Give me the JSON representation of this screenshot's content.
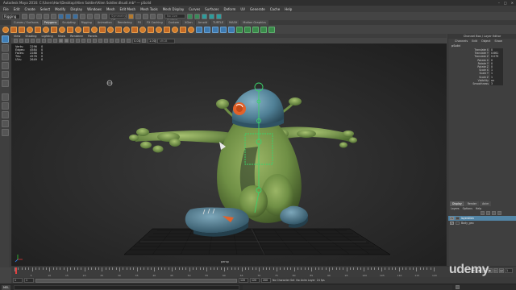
{
  "window": {
    "title": "Autodesk Maya 2016: C:\\Users\\Hari\\Desktop\\Alien Soldier\\Alien Soldier.dlsudi.mb* --- pSolid"
  },
  "menubar": [
    "File",
    "Edit",
    "Create",
    "Select",
    "Modify",
    "Display",
    "Windows",
    "Mesh",
    "Edit Mesh",
    "Mesh Tools",
    "Mesh Display",
    "Curves",
    "Surfaces",
    "Deform",
    "UV",
    "Generate",
    "Cache",
    "Help"
  ],
  "statusline": {
    "mode": "Rigging",
    "search_placeholder": "Symmetry: Off",
    "live_label": "No Live Surface"
  },
  "shelf_tabs": [
    "Curves / Surfaces",
    "Polygons",
    "Sculpting",
    "Rigging",
    "Animation",
    "Rendering",
    "FX",
    "FX Caching",
    "Custom",
    "XGen",
    "Arnold",
    "TURTLE",
    "MASH",
    "Motion Graphics"
  ],
  "active_shelf_tab": "Polygons",
  "panel_menu": [
    "View",
    "Shading",
    "Lighting",
    "Show",
    "Renderer",
    "Panels"
  ],
  "hud": {
    "rows": [
      {
        "label": "Verts:",
        "a": "2296",
        "b": "0"
      },
      {
        "label": "Edges:",
        "a": "4584",
        "b": "0"
      },
      {
        "label": "Faces:",
        "a": "2288",
        "b": "0"
      },
      {
        "label": "Tris:",
        "a": "4576",
        "b": "0"
      },
      {
        "label": "UVs:",
        "a": "2649",
        "b": "0"
      }
    ]
  },
  "viewport": {
    "camera_label": "persp",
    "paneltool_values": [
      "0.00",
      "1.00"
    ],
    "paneltool_colorspace": "sRGB gamma"
  },
  "channel_box": {
    "title": "Channel Box / Layer Editor",
    "menu": [
      "Channels",
      "Edit",
      "Object",
      "Show"
    ],
    "object": "pSolid",
    "attributes": [
      {
        "name": "Translate X",
        "value": "0"
      },
      {
        "name": "Translate Y",
        "value": "0.661"
      },
      {
        "name": "Translate Z",
        "value": "0.079"
      },
      {
        "name": "Rotate X",
        "value": "0"
      },
      {
        "name": "Rotate Y",
        "value": "0"
      },
      {
        "name": "Rotate Z",
        "value": "0"
      },
      {
        "name": "Scale X",
        "value": "1"
      },
      {
        "name": "Scale Y",
        "value": "1"
      },
      {
        "name": "Scale Z",
        "value": "1"
      },
      {
        "name": "Visibility",
        "value": "on"
      },
      {
        "name": "Smoothness",
        "value": "3"
      }
    ]
  },
  "layer_editor": {
    "tabs": [
      "Display",
      "Render",
      "Anim"
    ],
    "menu": [
      "Layers",
      "Options",
      "Help"
    ],
    "layers": [
      {
        "vis": "V",
        "name": "layerAlien",
        "selected": true
      },
      {
        "vis": "V",
        "name": "Body_geo",
        "selected": false
      }
    ]
  },
  "timeline": {
    "ticks": [
      "5",
      "10",
      "15",
      "20",
      "25",
      "30",
      "35",
      "40",
      "45",
      "50",
      "55",
      "60",
      "65",
      "70",
      "75",
      "80",
      "85",
      "90",
      "95",
      "100",
      "105",
      "110",
      "115",
      "120"
    ],
    "current_frame": "1",
    "playback_buttons": [
      "⏮",
      "◀",
      "◁",
      "▶",
      "▷",
      "⏭"
    ]
  },
  "range": {
    "start": "1",
    "start_inner": "1",
    "end_inner": "120",
    "end": "120",
    "end2": "200",
    "char_set": "No Character Set",
    "anim_layer": "No Anim Layer",
    "fps": "24 fps"
  },
  "command_line": {
    "label": "MEL"
  },
  "watermark": "udemy",
  "colors": {
    "body_green": "#6f8f45",
    "helmet_blue": "#4f7f95",
    "accent_orange": "#e2622a",
    "selection_green": "#3bd36b"
  }
}
